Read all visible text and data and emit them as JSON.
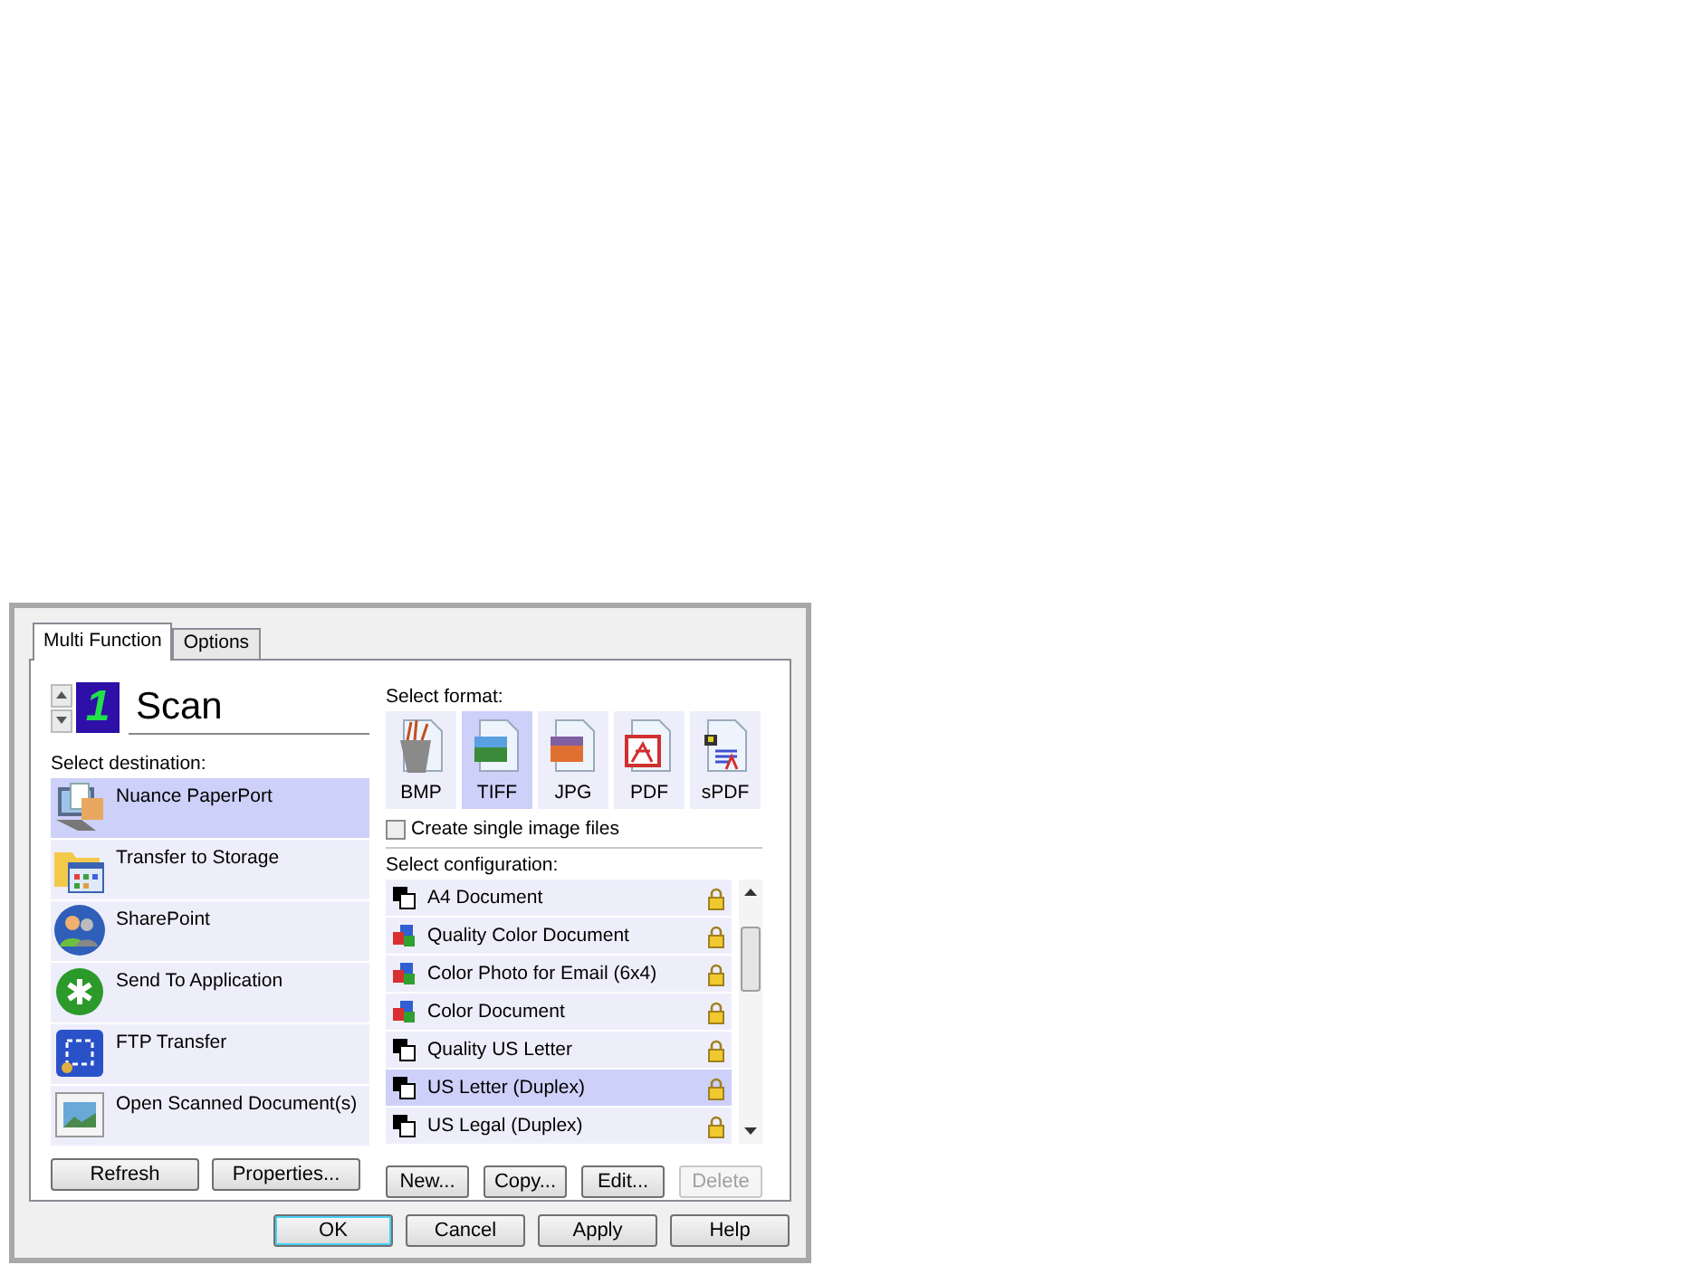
{
  "tabs": [
    {
      "label": "Multi Function",
      "selected": true
    },
    {
      "label": "Options",
      "selected": false
    }
  ],
  "counter": {
    "value": "1",
    "title": "Scan"
  },
  "destination": {
    "label": "Select destination:",
    "items": [
      {
        "kind": "paperport",
        "label": "Nuance PaperPort",
        "selected": true
      },
      {
        "kind": "storage",
        "label": "Transfer to Storage",
        "selected": false
      },
      {
        "kind": "sharepoint",
        "label": "SharePoint",
        "selected": false
      },
      {
        "kind": "application",
        "label": "Send To Application",
        "selected": false
      },
      {
        "kind": "ftp",
        "label": "FTP Transfer",
        "selected": false
      },
      {
        "kind": "open",
        "label": "Open Scanned Document(s)",
        "selected": false
      }
    ],
    "buttons": [
      {
        "label": "Refresh",
        "disabled": false
      },
      {
        "label": "Properties...",
        "disabled": false
      }
    ]
  },
  "format": {
    "label": "Select format:",
    "items": [
      {
        "kind": "bmp",
        "label": "BMP",
        "selected": false
      },
      {
        "kind": "tiff",
        "label": "TIFF",
        "selected": true
      },
      {
        "kind": "jpg",
        "label": "JPG",
        "selected": false
      },
      {
        "kind": "pdf",
        "label": "PDF",
        "selected": false
      },
      {
        "kind": "spdf",
        "label": "sPDF",
        "selected": false
      }
    ]
  },
  "single_files": {
    "label": "Create single image files",
    "checked": false
  },
  "configuration": {
    "label": "Select configuration:",
    "items": [
      {
        "kind": "bw",
        "label": "A4 Document",
        "selected": false,
        "locked": true
      },
      {
        "kind": "color",
        "label": "Quality Color Document",
        "selected": false,
        "locked": true
      },
      {
        "kind": "color",
        "label": "Color Photo for Email (6x4)",
        "selected": false,
        "locked": true
      },
      {
        "kind": "color",
        "label": "Color Document",
        "selected": false,
        "locked": true
      },
      {
        "kind": "bw",
        "label": "Quality US Letter",
        "selected": false,
        "locked": true
      },
      {
        "kind": "bw",
        "label": "US Letter (Duplex)",
        "selected": true,
        "locked": true
      },
      {
        "kind": "bw",
        "label": "US Legal (Duplex)",
        "selected": false,
        "locked": true
      }
    ],
    "buttons": [
      {
        "label": "New...",
        "disabled": false
      },
      {
        "label": "Copy...",
        "disabled": false
      },
      {
        "label": "Edit...",
        "disabled": false
      },
      {
        "label": "Delete",
        "disabled": true
      }
    ]
  },
  "dialog_buttons": [
    {
      "label": "OK",
      "default": true
    },
    {
      "label": "Cancel",
      "default": false
    },
    {
      "label": "Apply",
      "default": false
    },
    {
      "label": "Help",
      "default": false
    }
  ]
}
